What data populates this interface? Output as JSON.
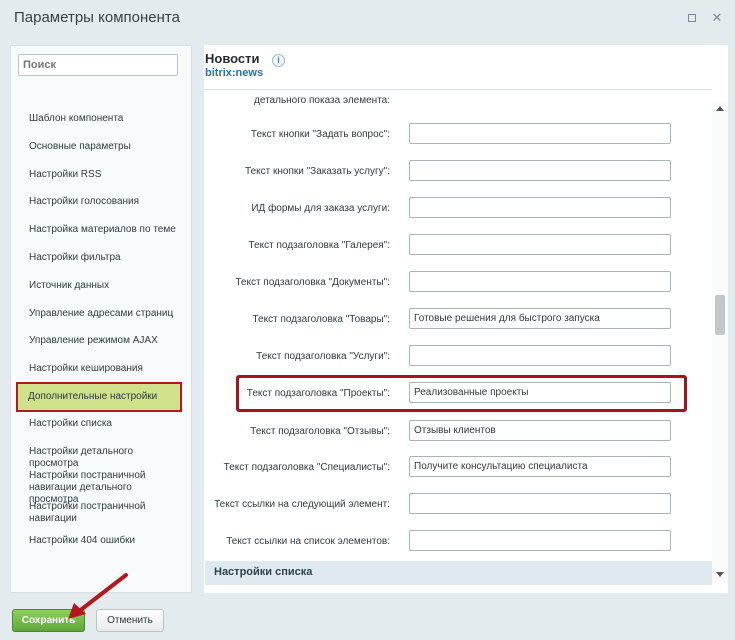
{
  "window": {
    "title": "Параметры компонента"
  },
  "sidebar": {
    "search_placeholder": "Поиск",
    "items": [
      "Шаблон компонента",
      "Основные параметры",
      "Настройки RSS",
      "Настройки голосования",
      "Настройка материалов по теме",
      "Настройки фильтра",
      "Источник данных",
      "Управление адресами страниц",
      "Управление режимом AJAX",
      "Настройки кеширования",
      "Дополнительные настройки",
      "Настройки списка",
      "Настройки детального просмотра",
      "Настройки постраничной навигации детального просмотра",
      "Настройки постраничной навигации",
      "Настройки 404 ошибки"
    ],
    "active_index": 10
  },
  "content": {
    "title": "Новости",
    "subtitle": "bitrix:news",
    "partial_label": "детального показа элемента:",
    "fields": [
      {
        "label": "Текст кнопки \"Задать вопрос\":",
        "value": ""
      },
      {
        "label": "Текст кнопки \"Заказать услугу\":",
        "value": ""
      },
      {
        "label": "ИД формы для заказа услуги:",
        "value": ""
      },
      {
        "label": "Текст подзаголовка \"Галерея\":",
        "value": ""
      },
      {
        "label": "Текст подзаголовка \"Документы\":",
        "value": ""
      },
      {
        "label": "Текст подзаголовка \"Товары\":",
        "value": "Готовые решения для быстрого запуска"
      },
      {
        "label": "Текст подзаголовка \"Услуги\":",
        "value": ""
      },
      {
        "label": "Текст подзаголовка \"Проекты\":",
        "value": "Реализованные проекты"
      },
      {
        "label": "Текст подзаголовка \"Отзывы\":",
        "value": "Отзывы клиентов"
      },
      {
        "label": "Текст подзаголовка \"Специалисты\":",
        "value": "Получите консультацию специалиста"
      },
      {
        "label": "Текст ссылки на следующий элемент:",
        "value": ""
      },
      {
        "label": "Текст ссылки на список элементов:",
        "value": ""
      }
    ],
    "section_label": "Настройки списка"
  },
  "footer": {
    "save_label": "Сохранить",
    "cancel_label": "Отменить"
  },
  "colors": {
    "save_green": "#6bb542",
    "highlight_red": "#a8131b",
    "active_item": "#cfe18a"
  }
}
